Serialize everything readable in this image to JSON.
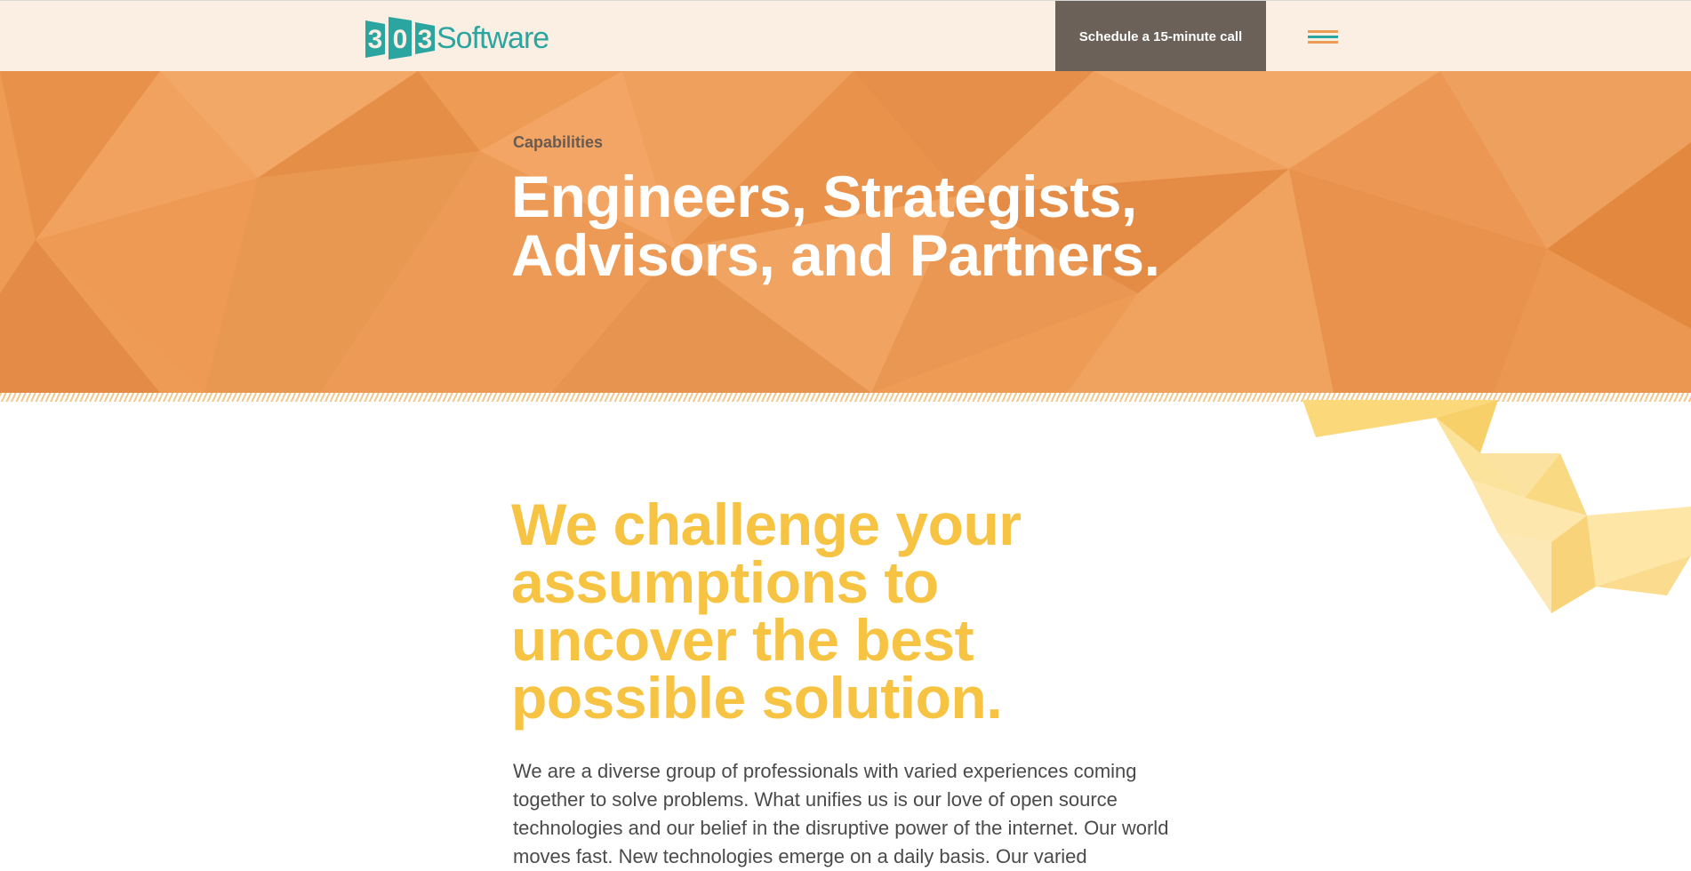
{
  "header": {
    "logo_digits": "303",
    "logo_text": "Software",
    "cta_label": "Schedule a 15-minute call",
    "menu_icon": "hamburger-menu-icon"
  },
  "hero": {
    "eyebrow": "Capabilities",
    "title": "Engineers, Strategists, Advisors, and Partners."
  },
  "content": {
    "heading": "We challenge your assumptions to uncover the best possible solution.",
    "intro": "We are a diverse group of professionals with varied experiences coming together to solve problems. What unifies us is our love of open source technologies and our belief in the disruptive power of the internet. Our world moves fast. New technologies emerge on a daily basis. Our varied"
  },
  "colors": {
    "header_bg": "#fbefe4",
    "brand_teal": "#2aa5a0",
    "cta_bg": "#6b6158",
    "hero_orange": "#ee9c55",
    "heading_yellow": "#f6c343",
    "body_text": "#4a4a4a"
  }
}
